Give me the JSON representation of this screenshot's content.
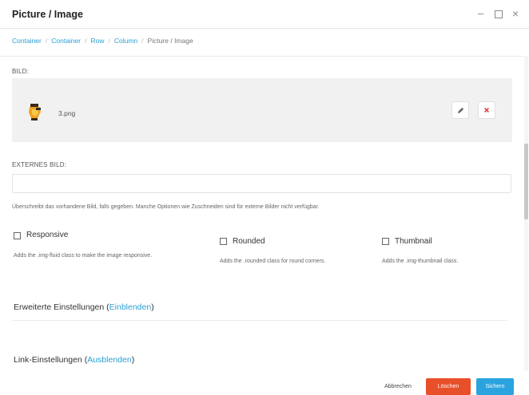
{
  "window": {
    "title": "Picture / Image",
    "controls": {
      "minimize": "–",
      "close": "×"
    }
  },
  "breadcrumb": {
    "items": [
      "Container",
      "Container",
      "Row",
      "Column"
    ],
    "current": "Picture / Image",
    "separator": "/"
  },
  "image_section": {
    "label": "BILD:",
    "filename": "3.png"
  },
  "external_image": {
    "label": "EXTERNES BILD:",
    "value": "",
    "help": "Überschreibt das vorhandene Bild, falls gegeben. Manche Optionen wie Zuschneiden sind für externe Bilder nicht verfügbar."
  },
  "options": [
    {
      "label": "Responsive",
      "checked": false,
      "help": "Adds the .img-fluid class to make the image responsive."
    },
    {
      "label": "Rounded",
      "checked": false,
      "help": "Adds the .rounded class for round corners."
    },
    {
      "label": "Thumbnail",
      "checked": false,
      "help": "Adds the .img-thumbnail class."
    }
  ],
  "sections": {
    "advanced": {
      "title": "Erweiterte Einstellungen (",
      "link": "Einblenden",
      "close": ")"
    },
    "link": {
      "title": "Link-Einstellungen (",
      "link": "Ausblenden",
      "close": ")"
    }
  },
  "footer": {
    "cancel": "Abbrechen",
    "delete": "Löschen",
    "save": "Sichern"
  },
  "colors": {
    "accent": "#2a9fd6",
    "danger": "#e8502a",
    "primary": "#2aa3de"
  },
  "icons": {
    "edit": "pencil-icon",
    "delete": "x-icon",
    "file": "image-file-icon"
  }
}
